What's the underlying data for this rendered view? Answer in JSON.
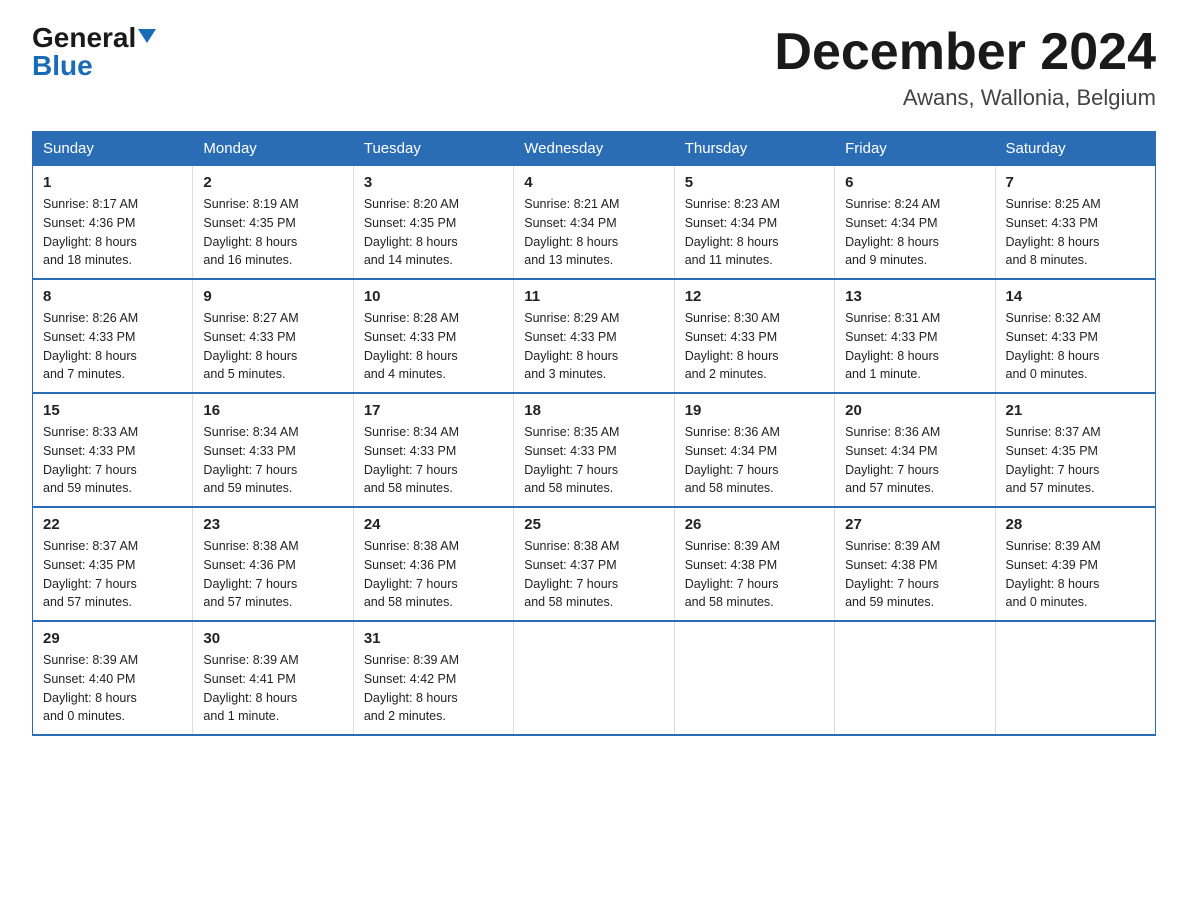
{
  "header": {
    "logo_general": "General",
    "logo_blue": "Blue",
    "month_title": "December 2024",
    "location": "Awans, Wallonia, Belgium"
  },
  "days_of_week": [
    "Sunday",
    "Monday",
    "Tuesday",
    "Wednesday",
    "Thursday",
    "Friday",
    "Saturday"
  ],
  "weeks": [
    [
      {
        "day": "1",
        "sunrise": "8:17 AM",
        "sunset": "4:36 PM",
        "daylight": "8 hours and 18 minutes."
      },
      {
        "day": "2",
        "sunrise": "8:19 AM",
        "sunset": "4:35 PM",
        "daylight": "8 hours and 16 minutes."
      },
      {
        "day": "3",
        "sunrise": "8:20 AM",
        "sunset": "4:35 PM",
        "daylight": "8 hours and 14 minutes."
      },
      {
        "day": "4",
        "sunrise": "8:21 AM",
        "sunset": "4:34 PM",
        "daylight": "8 hours and 13 minutes."
      },
      {
        "day": "5",
        "sunrise": "8:23 AM",
        "sunset": "4:34 PM",
        "daylight": "8 hours and 11 minutes."
      },
      {
        "day": "6",
        "sunrise": "8:24 AM",
        "sunset": "4:34 PM",
        "daylight": "8 hours and 9 minutes."
      },
      {
        "day": "7",
        "sunrise": "8:25 AM",
        "sunset": "4:33 PM",
        "daylight": "8 hours and 8 minutes."
      }
    ],
    [
      {
        "day": "8",
        "sunrise": "8:26 AM",
        "sunset": "4:33 PM",
        "daylight": "8 hours and 7 minutes."
      },
      {
        "day": "9",
        "sunrise": "8:27 AM",
        "sunset": "4:33 PM",
        "daylight": "8 hours and 5 minutes."
      },
      {
        "day": "10",
        "sunrise": "8:28 AM",
        "sunset": "4:33 PM",
        "daylight": "8 hours and 4 minutes."
      },
      {
        "day": "11",
        "sunrise": "8:29 AM",
        "sunset": "4:33 PM",
        "daylight": "8 hours and 3 minutes."
      },
      {
        "day": "12",
        "sunrise": "8:30 AM",
        "sunset": "4:33 PM",
        "daylight": "8 hours and 2 minutes."
      },
      {
        "day": "13",
        "sunrise": "8:31 AM",
        "sunset": "4:33 PM",
        "daylight": "8 hours and 1 minute."
      },
      {
        "day": "14",
        "sunrise": "8:32 AM",
        "sunset": "4:33 PM",
        "daylight": "8 hours and 0 minutes."
      }
    ],
    [
      {
        "day": "15",
        "sunrise": "8:33 AM",
        "sunset": "4:33 PM",
        "daylight": "7 hours and 59 minutes."
      },
      {
        "day": "16",
        "sunrise": "8:34 AM",
        "sunset": "4:33 PM",
        "daylight": "7 hours and 59 minutes."
      },
      {
        "day": "17",
        "sunrise": "8:34 AM",
        "sunset": "4:33 PM",
        "daylight": "7 hours and 58 minutes."
      },
      {
        "day": "18",
        "sunrise": "8:35 AM",
        "sunset": "4:33 PM",
        "daylight": "7 hours and 58 minutes."
      },
      {
        "day": "19",
        "sunrise": "8:36 AM",
        "sunset": "4:34 PM",
        "daylight": "7 hours and 58 minutes."
      },
      {
        "day": "20",
        "sunrise": "8:36 AM",
        "sunset": "4:34 PM",
        "daylight": "7 hours and 57 minutes."
      },
      {
        "day": "21",
        "sunrise": "8:37 AM",
        "sunset": "4:35 PM",
        "daylight": "7 hours and 57 minutes."
      }
    ],
    [
      {
        "day": "22",
        "sunrise": "8:37 AM",
        "sunset": "4:35 PM",
        "daylight": "7 hours and 57 minutes."
      },
      {
        "day": "23",
        "sunrise": "8:38 AM",
        "sunset": "4:36 PM",
        "daylight": "7 hours and 57 minutes."
      },
      {
        "day": "24",
        "sunrise": "8:38 AM",
        "sunset": "4:36 PM",
        "daylight": "7 hours and 58 minutes."
      },
      {
        "day": "25",
        "sunrise": "8:38 AM",
        "sunset": "4:37 PM",
        "daylight": "7 hours and 58 minutes."
      },
      {
        "day": "26",
        "sunrise": "8:39 AM",
        "sunset": "4:38 PM",
        "daylight": "7 hours and 58 minutes."
      },
      {
        "day": "27",
        "sunrise": "8:39 AM",
        "sunset": "4:38 PM",
        "daylight": "7 hours and 59 minutes."
      },
      {
        "day": "28",
        "sunrise": "8:39 AM",
        "sunset": "4:39 PM",
        "daylight": "8 hours and 0 minutes."
      }
    ],
    [
      {
        "day": "29",
        "sunrise": "8:39 AM",
        "sunset": "4:40 PM",
        "daylight": "8 hours and 0 minutes."
      },
      {
        "day": "30",
        "sunrise": "8:39 AM",
        "sunset": "4:41 PM",
        "daylight": "8 hours and 1 minute."
      },
      {
        "day": "31",
        "sunrise": "8:39 AM",
        "sunset": "4:42 PM",
        "daylight": "8 hours and 2 minutes."
      },
      null,
      null,
      null,
      null
    ]
  ],
  "labels": {
    "sunrise": "Sunrise:",
    "sunset": "Sunset:",
    "daylight": "Daylight:"
  }
}
